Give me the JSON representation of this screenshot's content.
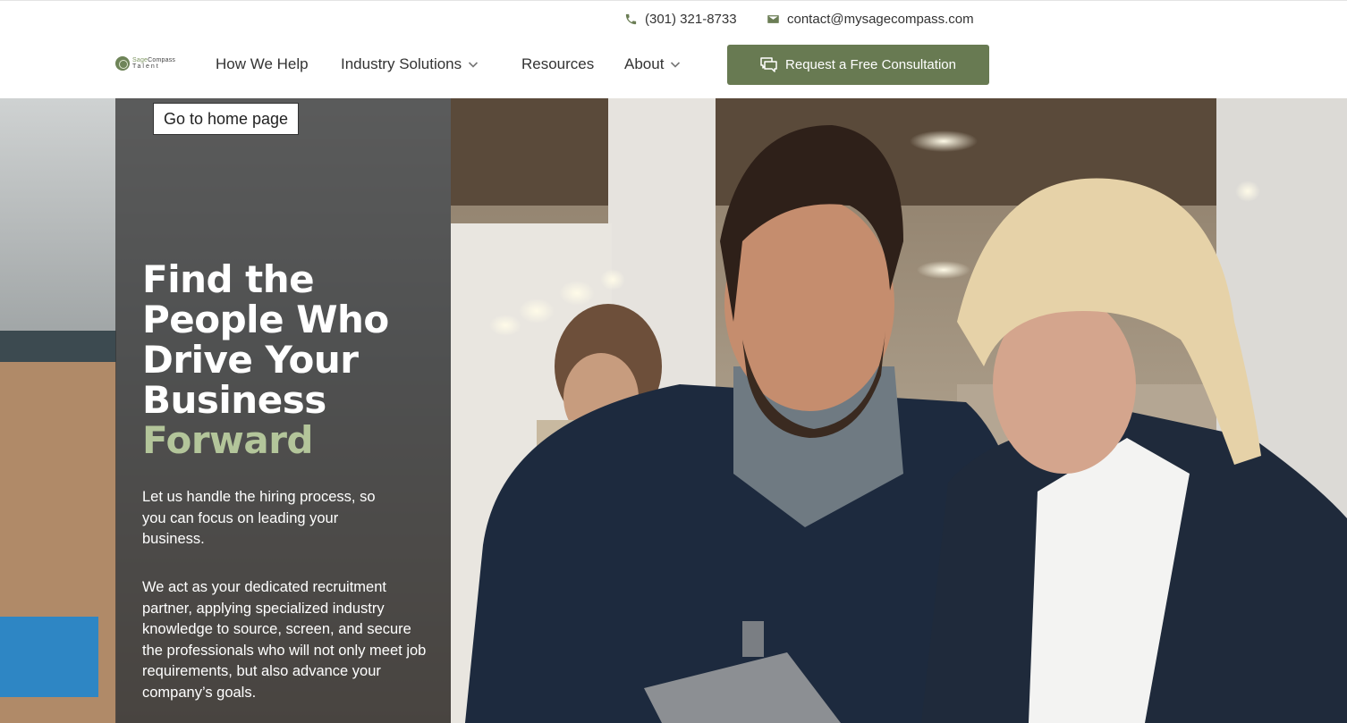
{
  "contact_bar": {
    "phone": "(301) 321-8733",
    "email": "contact@mysagecompass.com"
  },
  "logo": {
    "line1_a": "Sage",
    "line1_b": "Compass",
    "line2": "Talent"
  },
  "nav": {
    "items": [
      {
        "label": "How We Help"
      },
      {
        "label": "Industry Solutions",
        "has_dropdown": true
      },
      {
        "label": "Resources"
      },
      {
        "label": "About",
        "has_dropdown": true
      }
    ],
    "cta_label": "Request a Free Consultation"
  },
  "hero": {
    "home_link": "Go to home page",
    "headline_lines": [
      "Find the",
      "People Who",
      "Drive Your",
      "Business"
    ],
    "headline_accent": "Forward",
    "paragraph1": "Let us handle the hiring process, so you can focus on leading your business.",
    "paragraph2": "We act as your dedicated recruitment partner, applying specialized industry knowledge to source, screen, and secure the professionals who will not only meet job requirements, but also advance your company’s goals."
  },
  "colors": {
    "brand_green": "#687a52",
    "accent_green": "#b3c59a",
    "panel_overlay": "#3a3a3a"
  },
  "icons": [
    "phone-icon",
    "mail-icon",
    "chevron-down-icon",
    "chat-icon"
  ]
}
